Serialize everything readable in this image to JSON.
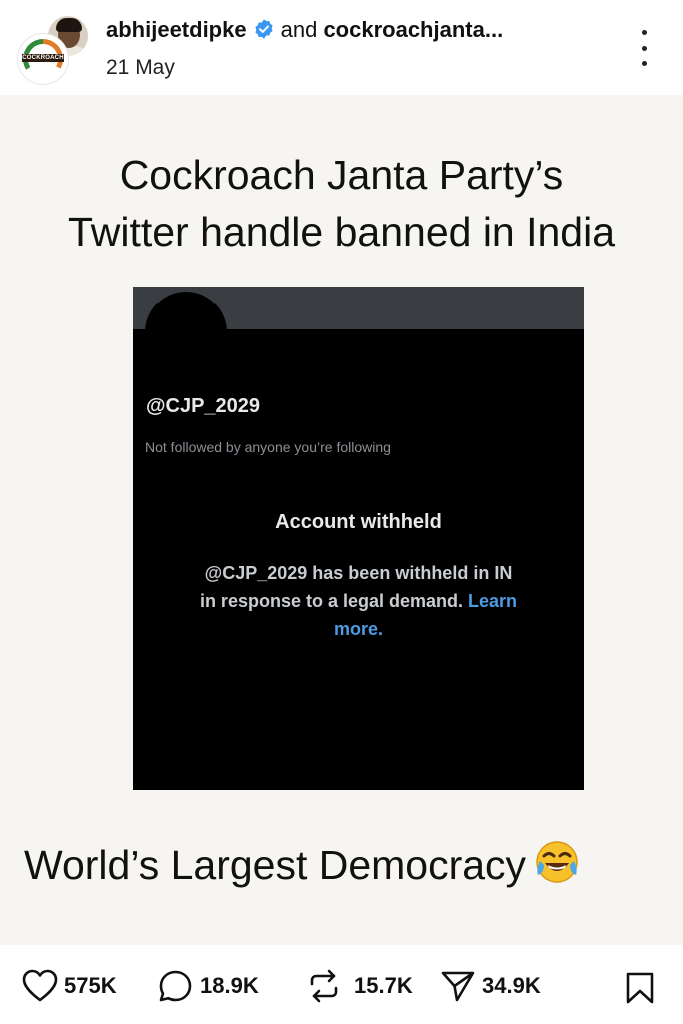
{
  "header": {
    "username": "abhijeetdipke",
    "joiner": "and",
    "collaborator": "cockroachjanta...",
    "date": "21 May",
    "collab_avatar_label": "COCKROACH"
  },
  "post": {
    "headline_line1": "Cockroach Janta Party’s",
    "headline_line2": "Twitter handle banned in India",
    "screenshot": {
      "handle": "@CJP_2029",
      "not_followed": "Not followed by anyone you’re following",
      "title": "Account withheld",
      "body_line1": "@CJP_2029 has been withheld in IN",
      "body_line2": "in response to a legal demand.",
      "learn": "Learn",
      "more": "more."
    },
    "caption": "World’s Largest Democracy",
    "caption_emoji": "face-with-tears-of-joy-icon"
  },
  "actions": {
    "likes": "575K",
    "comments": "18.9K",
    "reposts": "15.7K",
    "shares": "34.9K"
  },
  "colors": {
    "accent_link": "#4c9be3",
    "verified": "#3897f0",
    "post_bg": "#f7f5f1"
  }
}
